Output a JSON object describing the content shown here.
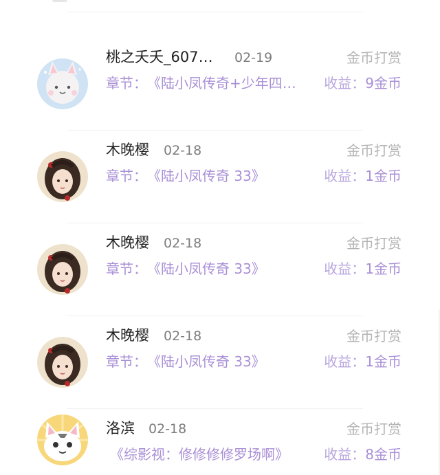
{
  "rows": [
    {
      "name": "桃之夭夭_607…",
      "date": "02-19",
      "reward_type": "金币打赏",
      "chapter_label": "章节：",
      "chapter_title": "《陆小凤传奇+少年四…",
      "earn_label": "收益：",
      "earn_value": "9金币",
      "avatar_icon": "cat-avatar-icon"
    },
    {
      "name": "木晚樱",
      "date": "02-18",
      "reward_type": "金币打赏",
      "chapter_label": "章节：",
      "chapter_title": "《陆小凤传奇 33》",
      "earn_label": "收益：",
      "earn_value": "1金币",
      "avatar_icon": "girl-avatar-icon"
    },
    {
      "name": "木晚樱",
      "date": "02-18",
      "reward_type": "金币打赏",
      "chapter_label": "章节：",
      "chapter_title": "《陆小凤传奇 33》",
      "earn_label": "收益：",
      "earn_value": "1金币",
      "avatar_icon": "girl-avatar-icon"
    },
    {
      "name": "木晚樱",
      "date": "02-18",
      "reward_type": "金币打赏",
      "chapter_label": "章节：",
      "chapter_title": "《陆小凤传奇 33》",
      "earn_label": "收益：",
      "earn_value": "1金币",
      "avatar_icon": "girl-avatar-icon"
    },
    {
      "name": "洛滨",
      "date": "02-18",
      "reward_type": "金币打赏",
      "chapter_label": "",
      "chapter_title": "《综影视：修修修修罗场啊》",
      "earn_label": "收益：",
      "earn_value": "8金币",
      "avatar_icon": "cartoon-cat-avatar-icon"
    }
  ],
  "colors": {
    "accent_purple": "#a98fd6",
    "name_text": "#222222",
    "muted_text": "#b3b3b3"
  }
}
